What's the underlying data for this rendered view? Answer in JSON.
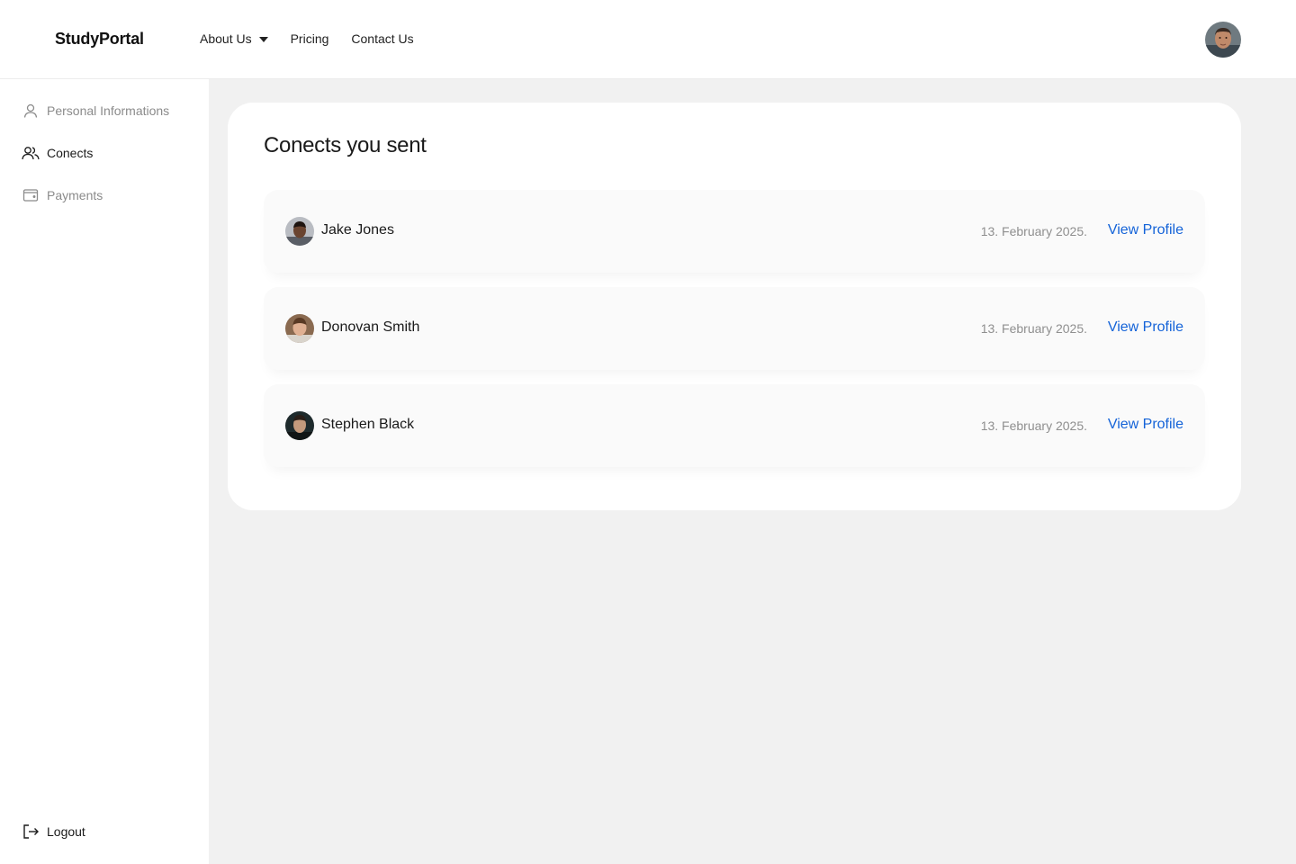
{
  "header": {
    "logo": "StudyPortal",
    "nav": [
      {
        "label": "About Us",
        "has_dropdown": true
      },
      {
        "label": "Pricing"
      },
      {
        "label": "Contact Us"
      }
    ],
    "avatar_icon": "user-avatar"
  },
  "sidebar": {
    "items": [
      {
        "label": "Personal Informations",
        "icon": "user-icon",
        "active": false
      },
      {
        "label": "Conects",
        "icon": "users-icon",
        "active": true
      },
      {
        "label": "Payments",
        "icon": "wallet-icon",
        "active": false
      }
    ],
    "logout": {
      "label": "Logout",
      "icon": "logout-icon"
    }
  },
  "main": {
    "title": "Conects you sent",
    "connections": [
      {
        "name": "Jake Jones",
        "date": "13. February 2025.",
        "action": "View Profile"
      },
      {
        "name": "Donovan Smith",
        "date": "13. February 2025.",
        "action": "View Profile"
      },
      {
        "name": "Stephen Black",
        "date": "13. February 2025.",
        "action": "View Profile"
      }
    ]
  },
  "colors": {
    "link": "#1463d8",
    "muted": "#8b8b8b",
    "background": "#f1f1f1",
    "surface": "#ffffff"
  }
}
